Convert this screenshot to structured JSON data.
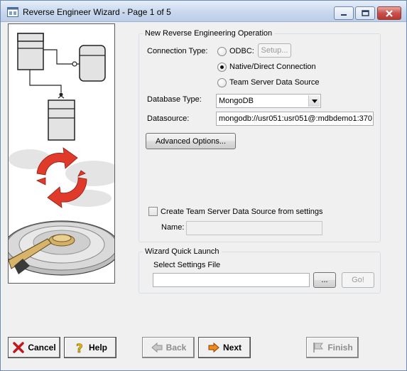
{
  "window": {
    "title": "Reverse Engineer Wizard - Page 1 of 5"
  },
  "operation": {
    "legend": "New Reverse Engineering Operation",
    "connection_type_label": "Connection Type:",
    "odbc_label": "ODBC:",
    "setup_button": "Setup...",
    "native_label": "Native/Direct Connection",
    "team_server_label": "Team Server Data Source",
    "selected_connection": "Native/Direct Connection",
    "database_type_label": "Database Type:",
    "database_type_value": "MongoDB",
    "datasource_label": "Datasource:",
    "datasource_value": "mongodb://usr051:usr051@:mdbdemo1:370",
    "advanced_button": "Advanced Options...",
    "create_checkbox_label": "Create Team Server Data Source from settings",
    "name_label": "Name:",
    "name_value": ""
  },
  "quick_launch": {
    "legend": "Wizard Quick Launch",
    "settings_label": "Select Settings File",
    "settings_value": "",
    "browse_button": "...",
    "go_button": "Go!"
  },
  "footer": {
    "cancel": "Cancel",
    "help": "Help",
    "back": "Back",
    "next": "Next",
    "finish": "Finish"
  }
}
